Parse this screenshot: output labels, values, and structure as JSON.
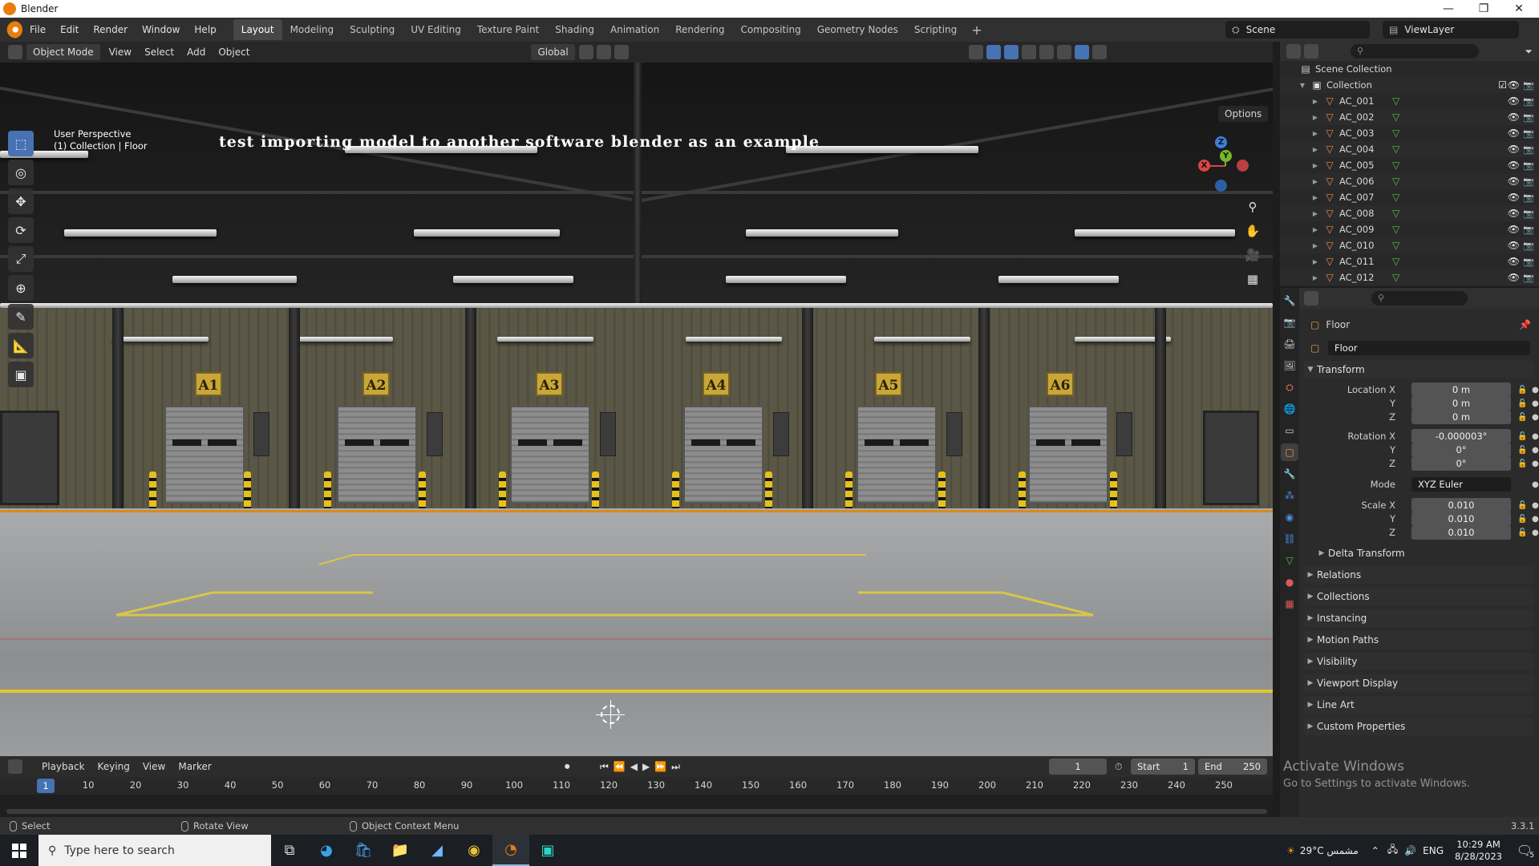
{
  "window": {
    "title": "Blender",
    "controls": [
      "—",
      "❐",
      "✕"
    ]
  },
  "menu": {
    "items": [
      "File",
      "Edit",
      "Render",
      "Window",
      "Help"
    ],
    "workspaces": [
      "Layout",
      "Modeling",
      "Sculpting",
      "UV Editing",
      "Texture Paint",
      "Shading",
      "Animation",
      "Rendering",
      "Compositing",
      "Geometry Nodes",
      "Scripting"
    ],
    "active_workspace": "Layout",
    "add_tab": "+",
    "scene": "Scene",
    "view_layer": "ViewLayer"
  },
  "viewport": {
    "mode": "Object Mode",
    "menus": [
      "View",
      "Select",
      "Add",
      "Object"
    ],
    "orientation": "Global",
    "options_label": "Options",
    "perspective": "User Perspective",
    "collection_info": "(1) Collection | Floor",
    "overlay_title": "test importing model to another software blender as an example",
    "bay_labels": [
      "A1",
      "A2",
      "A3",
      "A4",
      "A5",
      "A6"
    ],
    "gizmo": {
      "x": "X",
      "y": "Y",
      "z": "Z"
    }
  },
  "outliner": {
    "root": "Scene Collection",
    "collection": "Collection",
    "items": [
      "AC_001",
      "AC_002",
      "AC_003",
      "AC_004",
      "AC_005",
      "AC_006",
      "AC_007",
      "AC_008",
      "AC_009",
      "AC_010",
      "AC_011",
      "AC_012"
    ]
  },
  "properties": {
    "object_name": "Floor",
    "data_name": "Floor",
    "transform_label": "Transform",
    "location": {
      "label": "Location X",
      "x": "0 m",
      "y": "0 m",
      "z": "0 m"
    },
    "rotation": {
      "label": "Rotation X",
      "x": "-0.000003°",
      "y": "0°",
      "z": "0°"
    },
    "mode_label": "Mode",
    "mode_value": "XYZ Euler",
    "scale": {
      "label": "Scale X",
      "x": "0.010",
      "y": "0.010",
      "z": "0.010"
    },
    "axis_y": "Y",
    "axis_z": "Z",
    "panels": [
      "Delta Transform",
      "Relations",
      "Collections",
      "Instancing",
      "Motion Paths",
      "Visibility",
      "Viewport Display",
      "Line Art",
      "Custom Properties"
    ]
  },
  "timeline": {
    "menus": [
      "Playback",
      "Keying",
      "View",
      "Marker"
    ],
    "current_frame": "1",
    "start_label": "Start",
    "start_value": "1",
    "end_label": "End",
    "end_value": "250",
    "ticks": [
      "1",
      "10",
      "20",
      "30",
      "40",
      "50",
      "60",
      "70",
      "80",
      "90",
      "100",
      "110",
      "120",
      "130",
      "140",
      "150",
      "160",
      "170",
      "180",
      "190",
      "200",
      "210",
      "220",
      "230",
      "240",
      "250"
    ]
  },
  "statusbar": {
    "select": "Select",
    "rotate": "Rotate View",
    "context": "Object Context Menu",
    "version": "3.3.1"
  },
  "watermark": {
    "line1": "Activate Windows",
    "line2": "Go to Settings to activate Windows."
  },
  "taskbar": {
    "search_placeholder": "Type here to search",
    "weather": "29°C  مشمس",
    "language": "ENG",
    "time": "10:29 AM",
    "date": "8/28/2023",
    "notifications": "5"
  }
}
